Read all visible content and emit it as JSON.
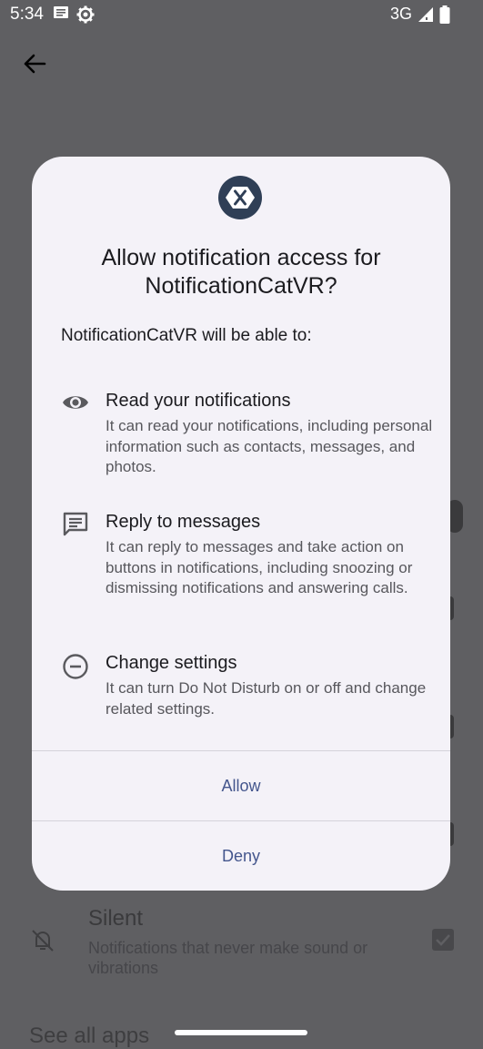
{
  "status_bar": {
    "time": "5:34",
    "network": "3G",
    "icons": [
      "message-icon",
      "settings-gear-icon",
      "signal-icon",
      "battery-icon"
    ]
  },
  "background": {
    "silent_title": "Silent",
    "silent_desc": "Notifications that never make sound or vibrations",
    "see_all": "See all apps"
  },
  "dialog": {
    "app_icon": "xamarin-logo-icon",
    "title": "Allow notification access for\nNotificationCatVR?",
    "subtitle": "NotificationCatVR will be able to:",
    "permissions": [
      {
        "icon": "eye-icon",
        "title": "Read your notifications",
        "description": "It can read your notifications, including personal information such as contacts, messages, and photos."
      },
      {
        "icon": "message-icon",
        "title": "Reply to messages",
        "description": "It can reply to messages and take action on buttons in notifications, including snoozing or dismissing notifications and answering calls."
      },
      {
        "icon": "minus-circle-icon",
        "title": "Change settings",
        "description": "It can turn Do Not Disturb on or off and change related settings."
      }
    ],
    "allow_label": "Allow",
    "deny_label": "Deny"
  },
  "colors": {
    "scrim": "#5f5f62",
    "dialog_bg": "#f4f2f8",
    "button_text": "#44568d",
    "app_icon_bg": "#2f3f56"
  }
}
